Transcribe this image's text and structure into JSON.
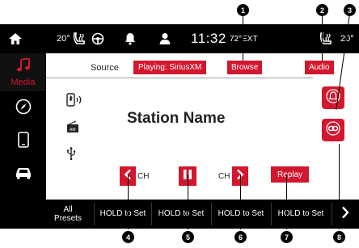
{
  "status_bar": {
    "left_temp": "20°",
    "clock": "11:32",
    "exterior_temp": "72°EXT",
    "right_temp": "20°"
  },
  "sidebar": {
    "items": [
      {
        "icon": "music-note-icon",
        "label": "Media",
        "active": true
      },
      {
        "icon": "compass-icon"
      },
      {
        "icon": "phone-icon"
      },
      {
        "icon": "car-icon"
      },
      {
        "icon": "apps-grid-icon"
      }
    ]
  },
  "media": {
    "source_label": "Source",
    "playing_label": "Playing: SiriusXM",
    "browse_label": "Browse",
    "audio_label": "Audio",
    "station_name": "Station Name",
    "ch_prev_label": "CH",
    "ch_next_label": "CH",
    "replay_label": "Replay"
  },
  "sources": [
    {
      "icon": "bluetooth-audio-icon"
    },
    {
      "icon": "am-radio-icon",
      "label": "AM"
    },
    {
      "icon": "usb-icon"
    }
  ],
  "presets": {
    "all_label": [
      "All",
      "Presets"
    ],
    "items": [
      "HOLD to Set",
      "HOLD to Set",
      "HOLD to Set",
      "HOLD to Set"
    ]
  },
  "callouts": [
    "1",
    "2",
    "3",
    "4",
    "5",
    "6",
    "7",
    "8"
  ],
  "colors": {
    "accent": "#d3172e",
    "bar": "#000000"
  }
}
